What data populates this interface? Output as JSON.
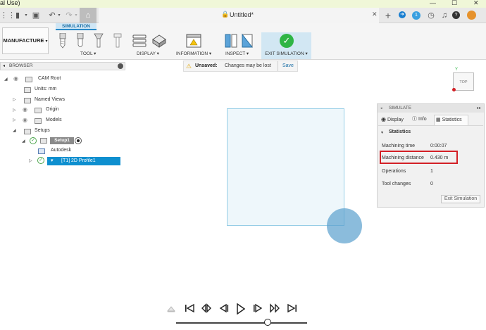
{
  "window": {
    "title": "al Use)"
  },
  "app_toolbar": {
    "document_title": "Untitled*",
    "counter": "1"
  },
  "ribbon": {
    "workspace": "MANUFACTURE",
    "active_tab": "SIMULATION",
    "groups": [
      "TOOL",
      "DISPLAY",
      "INFORMATION",
      "INSPECT",
      "EXIT SIMULATION"
    ]
  },
  "browser": {
    "title": "BROWSER",
    "items": [
      {
        "label": "CAM Root"
      },
      {
        "label": "Units: mm"
      },
      {
        "label": "Named Views"
      },
      {
        "label": "Origin"
      },
      {
        "label": "Models"
      },
      {
        "label": "Setups"
      },
      {
        "label": "Setup1"
      },
      {
        "label": "Autodesk"
      },
      {
        "label": "[T1] 2D Profile1"
      }
    ]
  },
  "unsaved_bar": {
    "status": "Unsaved:",
    "message": "Changes may be lost",
    "save_label": "Save"
  },
  "viewcube": {
    "face": "TOP",
    "axis_label": "Y"
  },
  "simulate_panel": {
    "title": "SIMULATE",
    "tabs": [
      "Display",
      "Info",
      "Statistics"
    ],
    "active_tab": "Statistics",
    "section": "Statistics",
    "rows": [
      {
        "label": "Machining time",
        "value": "0:00:07"
      },
      {
        "label": "Machining distance",
        "value": "0.430 m"
      },
      {
        "label": "Operations",
        "value": "1"
      },
      {
        "label": "Tool changes",
        "value": "0"
      }
    ],
    "exit_label": "Exit Simulation"
  },
  "playback": {
    "progress": 0.7
  },
  "colors": {
    "accent": "#0e8fcf",
    "highlight": "#d32026",
    "exit_check": "#2fb545"
  }
}
